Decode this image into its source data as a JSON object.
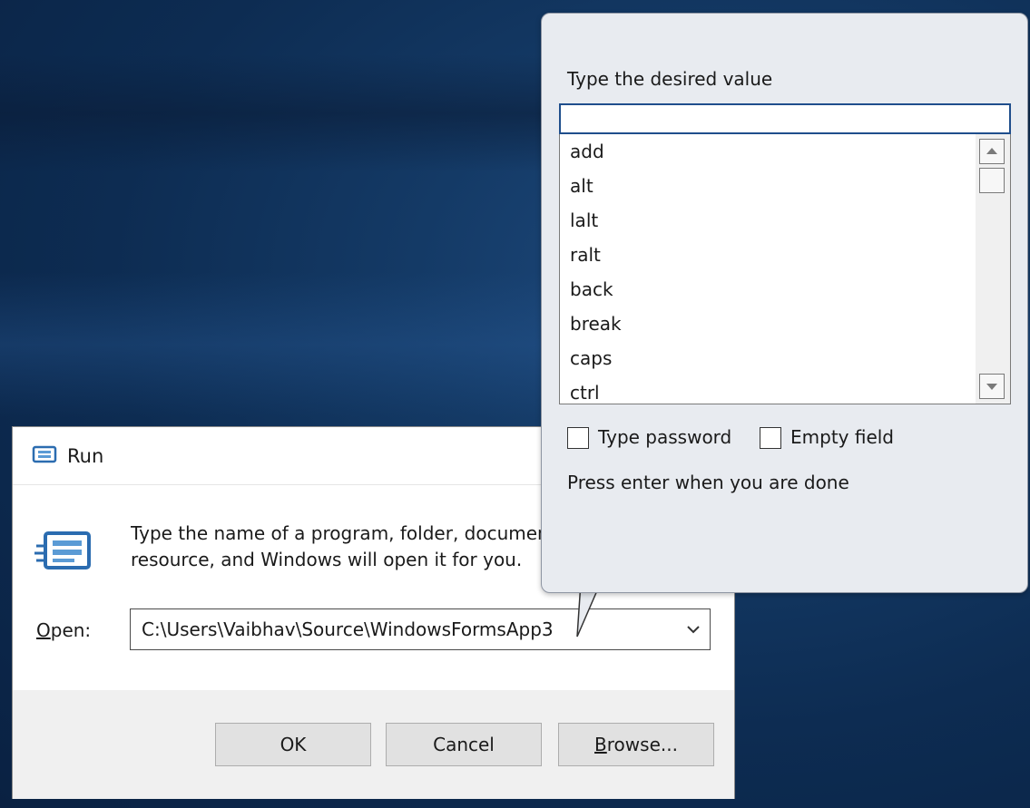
{
  "run_dialog": {
    "title": "Run",
    "description_line1": "Type the name of a program, folder, document, or Internet",
    "description_line2": "resource, and Windows will open it for you.",
    "open_label_prefix": "O",
    "open_label_rest": "pen:",
    "open_value": "C:\\Users\\Vaibhav\\Source\\WindowsFormsApp3",
    "ok_label": "OK",
    "cancel_label": "Cancel",
    "browse_label_prefix": "B",
    "browse_label_rest": "rowse..."
  },
  "popup": {
    "prompt": "Type the desired value",
    "input_value": "",
    "list_items": [
      "add",
      "alt",
      "lalt",
      "ralt",
      "back",
      "break",
      "caps",
      "ctrl"
    ],
    "type_password_label": "Type password",
    "empty_field_label": "Empty field",
    "done_text": "Press enter when you are done"
  },
  "colors": {
    "accent": "#1f4e8c",
    "run_icon": "#2b6cb0"
  }
}
